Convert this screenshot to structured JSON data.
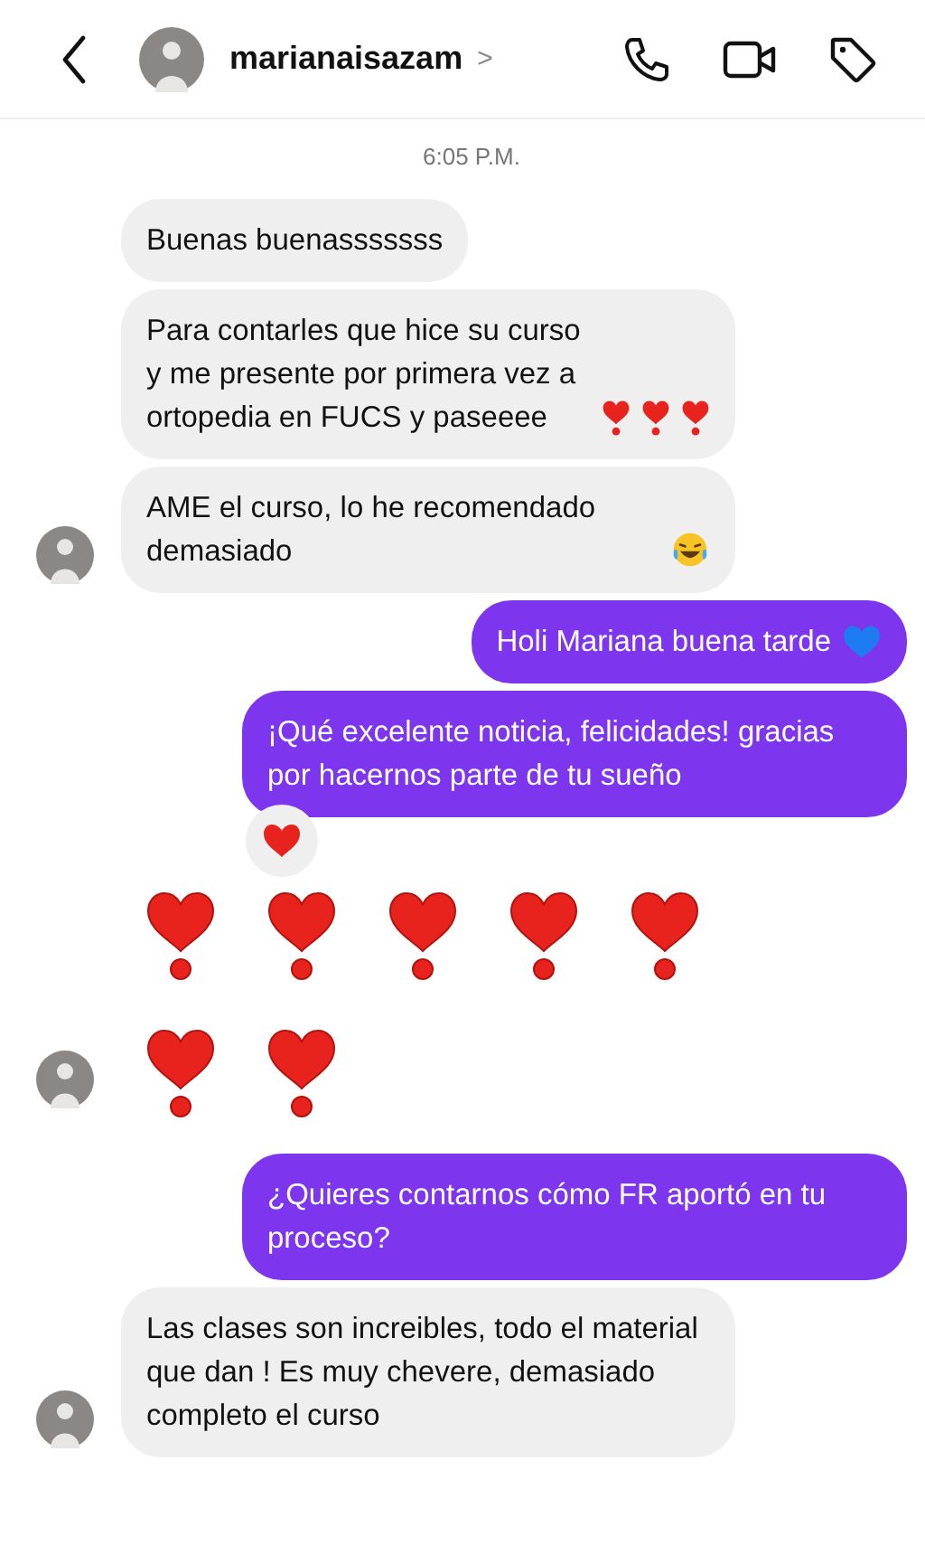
{
  "header": {
    "username": "marianaisazam",
    "chevron": ">"
  },
  "timestamp": "6:05 P.M.",
  "messages": [
    {
      "outgoing": false,
      "avatar": false,
      "text": "Buenas buenasssssss"
    },
    {
      "outgoing": false,
      "avatar": false,
      "text": "Para contarles que hice su curso y me presente por primera vez a ortopedia en FUCS y paseeee",
      "icons": [
        {
          "kind": "heart-exclamation"
        },
        {
          "kind": "heart-exclamation"
        },
        {
          "kind": "heart-exclamation"
        }
      ]
    },
    {
      "outgoing": false,
      "avatar": true,
      "text": "AME el curso, lo he recomendado demasiado",
      "icons": [
        {
          "kind": "laughing"
        }
      ]
    },
    {
      "outgoing": true,
      "text": "Holi Mariana buena tarde",
      "icons": [
        {
          "kind": "blue-heart"
        }
      ]
    },
    {
      "outgoing": true,
      "text": "¡Qué excelente noticia, felicidades! gracias por hacernos parte de tu sueño",
      "reaction": {
        "kind": "red-heart"
      }
    },
    {
      "outgoing": false,
      "avatar": true,
      "big_icons": [
        {
          "kind": "heart-exclamation"
        },
        {
          "kind": "heart-exclamation"
        },
        {
          "kind": "heart-exclamation"
        },
        {
          "kind": "heart-exclamation"
        },
        {
          "kind": "heart-exclamation"
        },
        {
          "kind": "heart-exclamation"
        },
        {
          "kind": "heart-exclamation"
        }
      ]
    },
    {
      "outgoing": true,
      "text": "¿Quieres contarnos cómo FR aportó en tu proceso?"
    },
    {
      "outgoing": false,
      "avatar": true,
      "text": "Las clases son increibles, todo el material que dan ! Es muy chevere, demasiado completo el curso"
    }
  ]
}
